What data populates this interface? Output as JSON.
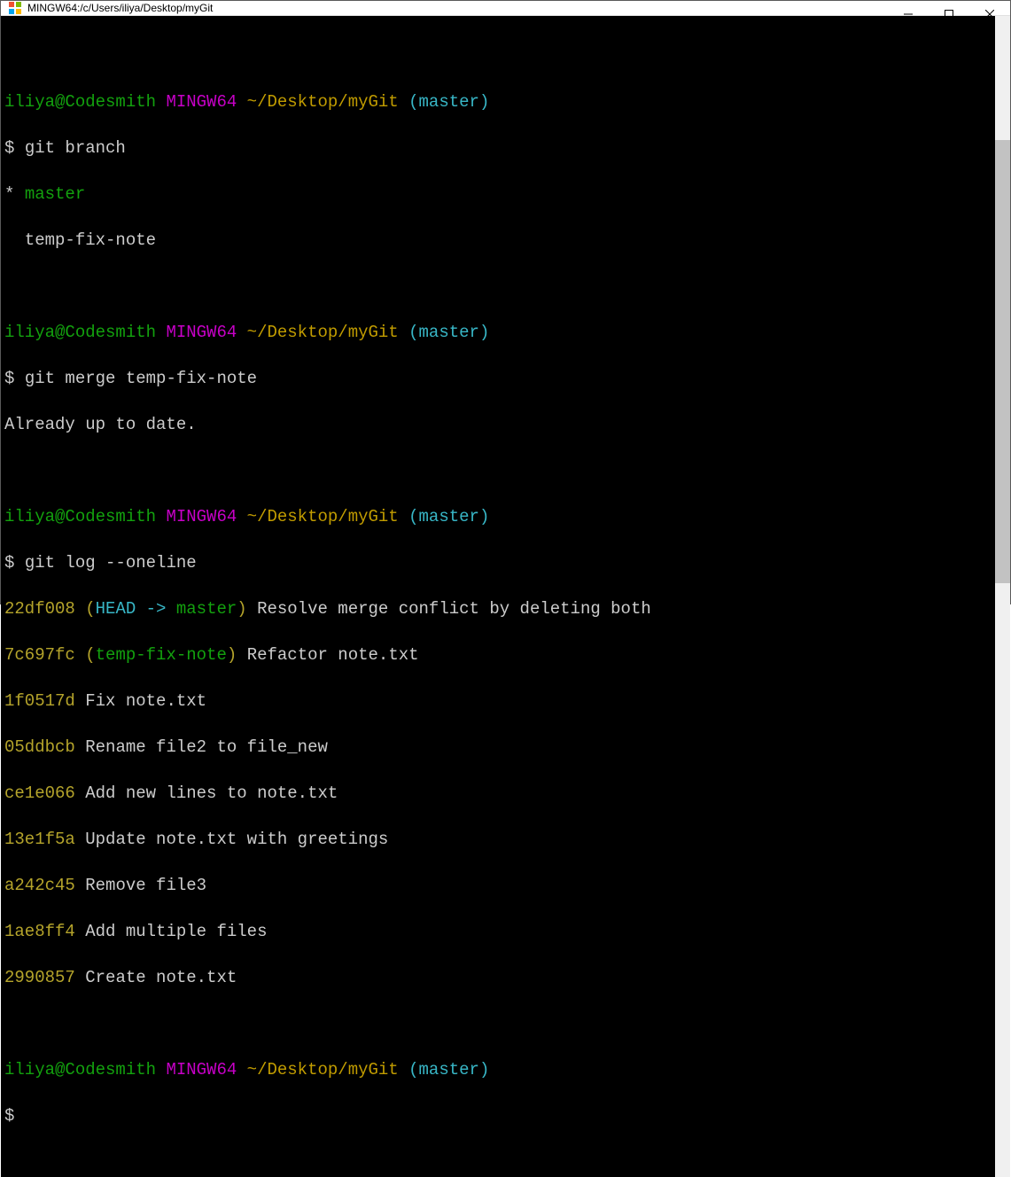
{
  "window": {
    "title": "MINGW64:/c/Users/iliya/Desktop/myGit"
  },
  "prompt": {
    "user_host": "iliya@Codesmith",
    "msys": "MINGW64",
    "path": "~/Desktop/myGit",
    "branch_open": "(",
    "branch": "master",
    "branch_close": ")",
    "dollar": "$"
  },
  "cmd": {
    "branch": "git branch",
    "merge": "git merge temp-fix-note",
    "log": "git log --oneline"
  },
  "branch_output": {
    "current_marker": "*",
    "current": "master",
    "other": "  temp-fix-note"
  },
  "merge_output": "Already up to date.",
  "log": [
    {
      "hash": "22df008",
      "refs_open": "(",
      "head": "HEAD -> ",
      "head_branch": "master",
      "refs_close": ")",
      "msg": "Resolve merge conflict by deleting both"
    },
    {
      "hash": "7c697fc",
      "refs_open": "(",
      "ref_branch": "temp-fix-note",
      "refs_close": ")",
      "msg": "Refactor note.txt"
    },
    {
      "hash": "1f0517d",
      "msg": "Fix note.txt"
    },
    {
      "hash": "05ddbcb",
      "msg": "Rename file2 to file_new"
    },
    {
      "hash": "ce1e066",
      "msg": "Add new lines to note.txt"
    },
    {
      "hash": "13e1f5a",
      "msg": "Update note.txt with greetings"
    },
    {
      "hash": "a242c45",
      "msg": "Remove file3"
    },
    {
      "hash": "1ae8ff4",
      "msg": "Add multiple files"
    },
    {
      "hash": "2990857",
      "msg": "Create note.txt"
    }
  ]
}
